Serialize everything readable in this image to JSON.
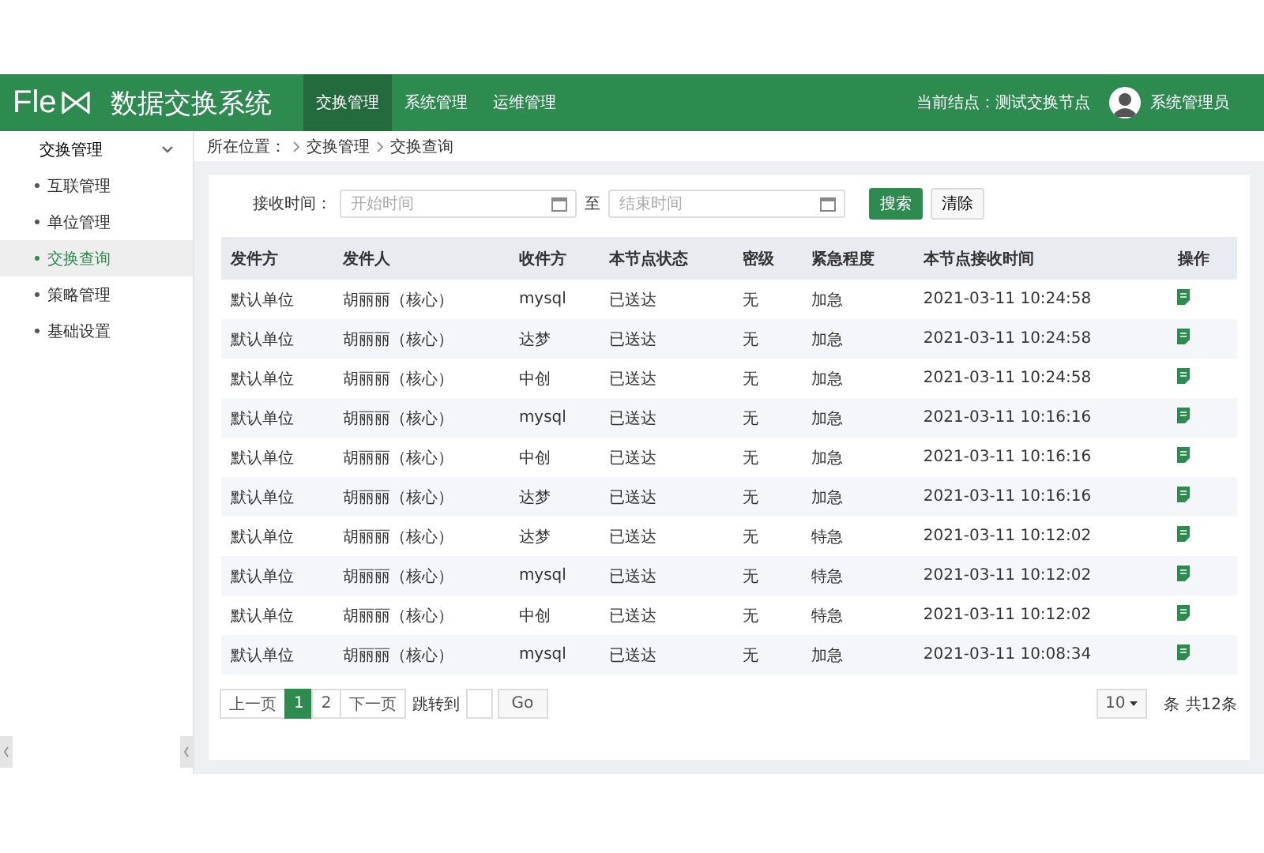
{
  "header": {
    "logo_text": "Fle",
    "title": "数据交换系统",
    "nav": [
      {
        "label": "交换管理",
        "selected": true
      },
      {
        "label": "系统管理",
        "selected": false
      },
      {
        "label": "运维管理",
        "selected": false
      }
    ],
    "node": "当前结点：测试交换节点",
    "user": "系统管理员"
  },
  "sidebar": {
    "group": {
      "label": "交换管理",
      "expanded": true
    },
    "items": [
      {
        "label": "互联管理",
        "selected": false
      },
      {
        "label": "单位管理",
        "selected": false
      },
      {
        "label": "交换查询",
        "selected": true
      },
      {
        "label": "策略管理",
        "selected": false
      },
      {
        "label": "基础设置",
        "selected": false
      }
    ]
  },
  "breadcrumb": {
    "label": "所在位置：",
    "items": [
      "交换管理",
      "交换查询"
    ]
  },
  "filter": {
    "label": "接收时间：",
    "start_placeholder": "开始时间",
    "to": "至",
    "end_placeholder": "结束时间",
    "buttons": [
      "搜索",
      "清除"
    ]
  },
  "table": {
    "columns": [
      "发件方",
      "发件人",
      "收件方",
      "本节点状态",
      "密级",
      "紧急程度",
      "本节点接收时间",
      "操作"
    ],
    "rows": [
      [
        "默认单位",
        "胡丽丽（核心）",
        "mysql",
        "已送达",
        "无",
        "加急",
        "2021-03-11 10:24:58"
      ],
      [
        "默认单位",
        "胡丽丽（核心）",
        "达梦",
        "已送达",
        "无",
        "加急",
        "2021-03-11 10:24:58"
      ],
      [
        "默认单位",
        "胡丽丽（核心）",
        "中创",
        "已送达",
        "无",
        "加急",
        "2021-03-11 10:24:58"
      ],
      [
        "默认单位",
        "胡丽丽（核心）",
        "mysql",
        "已送达",
        "无",
        "加急",
        "2021-03-11 10:16:16"
      ],
      [
        "默认单位",
        "胡丽丽（核心）",
        "中创",
        "已送达",
        "无",
        "加急",
        "2021-03-11 10:16:16"
      ],
      [
        "默认单位",
        "胡丽丽（核心）",
        "达梦",
        "已送达",
        "无",
        "加急",
        "2021-03-11 10:16:16"
      ],
      [
        "默认单位",
        "胡丽丽（核心）",
        "达梦",
        "已送达",
        "无",
        "特急",
        "2021-03-11 10:12:02"
      ],
      [
        "默认单位",
        "胡丽丽（核心）",
        "mysql",
        "已送达",
        "无",
        "特急",
        "2021-03-11 10:12:02"
      ],
      [
        "默认单位",
        "胡丽丽（核心）",
        "中创",
        "已送达",
        "无",
        "特急",
        "2021-03-11 10:12:02"
      ],
      [
        "默认单位",
        "胡丽丽（核心）",
        "mysql",
        "已送达",
        "无",
        "加急",
        "2021-03-11 10:08:34"
      ]
    ]
  },
  "pagination": {
    "prev": "上一页",
    "pages": [
      {
        "label": "1",
        "selected": true
      },
      {
        "label": "2",
        "selected": false
      }
    ],
    "next": "下一页",
    "jump_label": "跳转到",
    "go": "Go",
    "page_size": "10",
    "unit": "条",
    "total": "共12条"
  }
}
